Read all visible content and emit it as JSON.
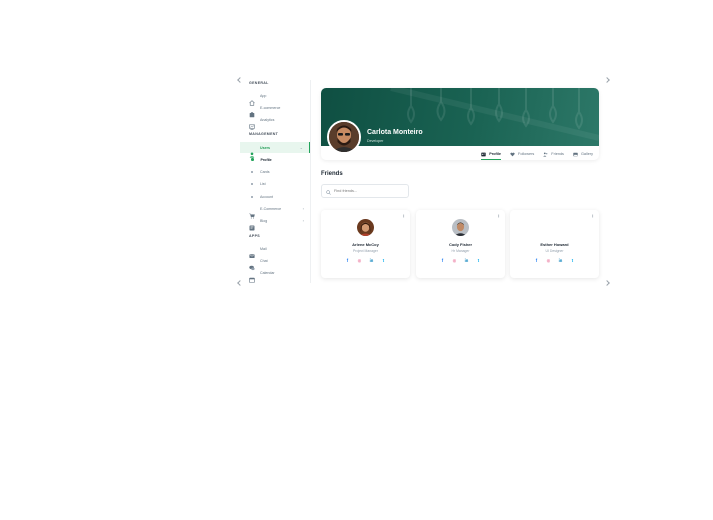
{
  "sidebar": {
    "general_label": "GENERAL",
    "general": [
      {
        "label": "App",
        "icon": "home-icon"
      },
      {
        "label": "E-commerce",
        "icon": "shop-icon"
      },
      {
        "label": "Analytics",
        "icon": "chart-icon"
      }
    ],
    "management_label": "MANAGEMENT",
    "user": {
      "label": "Users",
      "icon": "user-icon"
    },
    "user_subitems": [
      "Profile",
      "Cards",
      "List",
      "Account"
    ],
    "ecommerce": {
      "label": "E-Commerce",
      "icon": "cart-icon"
    },
    "blog": {
      "label": "Blog",
      "icon": "blog-icon"
    },
    "apps_label": "APPS",
    "apps": [
      {
        "label": "Mail",
        "icon": "mail-icon"
      },
      {
        "label": "Chat",
        "icon": "chat-icon"
      },
      {
        "label": "Calendar",
        "icon": "calendar-icon"
      }
    ]
  },
  "profile": {
    "name": "Carlota Monteiro",
    "role": "Developer",
    "tabs": [
      {
        "label": "Profile",
        "icon": "id-card-icon"
      },
      {
        "label": "Followers",
        "icon": "heart-icon"
      },
      {
        "label": "Friends",
        "icon": "people-icon"
      },
      {
        "label": "Gallery",
        "icon": "image-icon"
      }
    ],
    "active_tab": "Profile"
  },
  "friends": {
    "title": "Friends",
    "search_placeholder": "Find friends...",
    "cards": [
      {
        "name": "Arlene McCoy",
        "role": "Project Manager"
      },
      {
        "name": "Cody Fisher",
        "role": "Hr Manager"
      },
      {
        "name": "Esther Howard",
        "role": "UI Designer"
      }
    ],
    "social": [
      "f",
      "◎",
      "in",
      "t"
    ]
  },
  "colors": {
    "accent": "#22a35a",
    "cover": "#1a6353",
    "facebook": "#1877f2",
    "instagram": "#e02d69",
    "linkedin": "#007ebb",
    "twitter": "#00aaec"
  }
}
